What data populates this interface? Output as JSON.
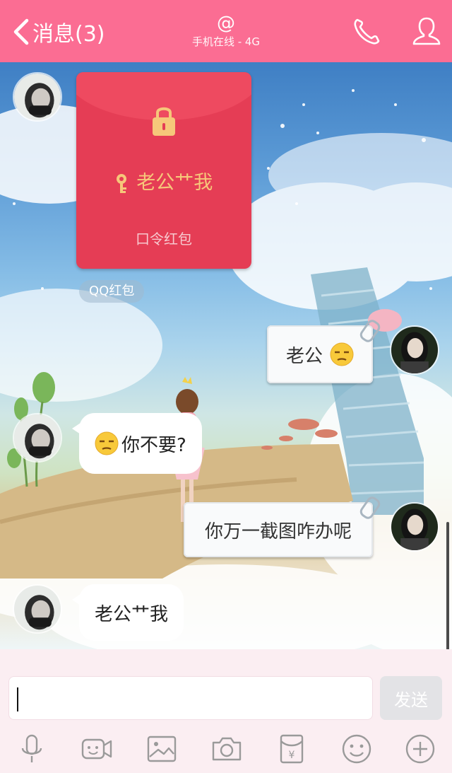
{
  "header": {
    "back_label": "消息(3)",
    "title": "@",
    "subtitle": "手机在线 - 4G",
    "bg_color": "#fb6d93",
    "icons": [
      "phone-icon",
      "person-icon"
    ]
  },
  "messages": [
    {
      "side": "in",
      "type": "red-packet",
      "code": "老公艹我",
      "packet_label": "口令红包",
      "tag": "QQ红包"
    },
    {
      "side": "out",
      "text": "老公",
      "emoji": "unamused"
    },
    {
      "side": "in",
      "text": "你不要?",
      "emoji": "unamused"
    },
    {
      "side": "out",
      "text": "你万一截图咋办呢"
    },
    {
      "side": "in",
      "text": "老公艹我"
    }
  ],
  "input": {
    "value": "",
    "placeholder": ""
  },
  "send_label": "发送",
  "toolbar": [
    "microphone-icon",
    "video-icon",
    "image-icon",
    "camera-icon",
    "red-packet-icon",
    "emoji-icon",
    "plus-icon"
  ],
  "colors": {
    "accent": "#fb6d93",
    "packet": "#e53d55",
    "packet_text": "#f6c77a"
  }
}
